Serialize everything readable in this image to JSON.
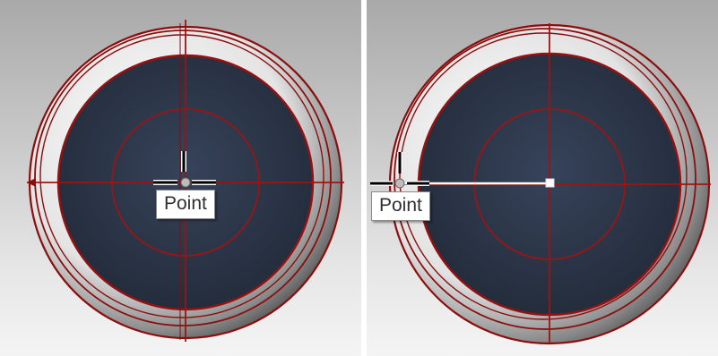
{
  "colors": {
    "curve_red": "#8b0e0e",
    "grid_red": "#a31a1a",
    "sphere_dark": "#2b3546",
    "background_top": "#a9a9a9",
    "background_bottom": "#f4f4f4",
    "cursor": "#000000",
    "rubber_band": "#ffffff"
  },
  "viewports": [
    {
      "tooltip": "Point",
      "icons": [
        "crosshair-cursor-icon",
        "point-marker-icon"
      ]
    },
    {
      "tooltip": "Point",
      "icons": [
        "crosshair-cursor-icon",
        "point-marker-icon",
        "center-point-icon"
      ]
    }
  ]
}
